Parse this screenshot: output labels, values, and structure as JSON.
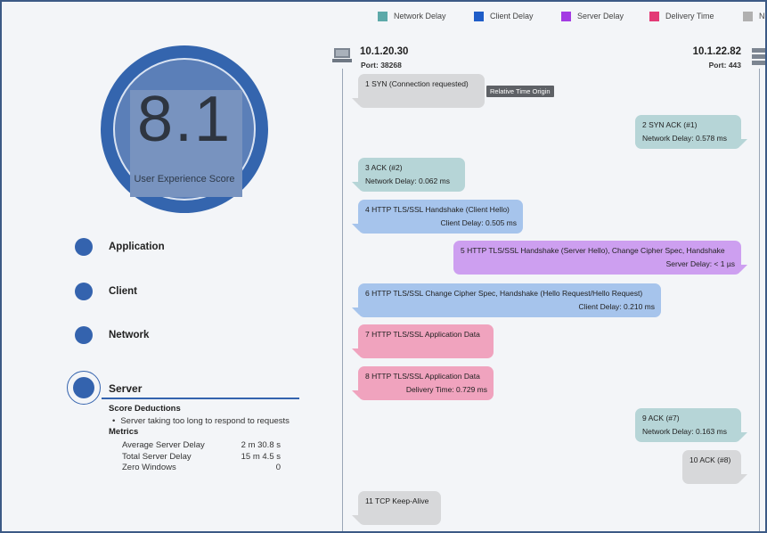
{
  "legend": [
    {
      "label": "Network Delay",
      "color": "#5da9a9"
    },
    {
      "label": "Client Delay",
      "color": "#1f5dc8"
    },
    {
      "label": "Server Delay",
      "color": "#a33be3"
    },
    {
      "label": "Delivery Time",
      "color": "#e33a76"
    },
    {
      "label": "N",
      "color": "#b0b0b0"
    }
  ],
  "score": {
    "value": "8.1",
    "label": "User Experience Score"
  },
  "categories": {
    "application": "Application",
    "client": "Client",
    "network": "Network",
    "server": "Server"
  },
  "details": {
    "deductions_heading": "Score Deductions",
    "deduction": "Server taking too long to respond to requests",
    "metrics_heading": "Metrics",
    "metrics": [
      {
        "name": "Average Server Delay",
        "value": "2 m 30.8 s"
      },
      {
        "name": "Total Server Delay",
        "value": "15 m 4.5 s"
      },
      {
        "name": "Zero Windows",
        "value": "0"
      }
    ]
  },
  "hosts": {
    "left": {
      "ip": "10.1.20.30",
      "port": "Port: 38268"
    },
    "right": {
      "ip": "10.1.22.82",
      "port": "Port: 443"
    }
  },
  "relative_time_origin": "Relative Time Origin",
  "messages": [
    {
      "l1": "1   SYN (Connection requested)",
      "l2": ""
    },
    {
      "l1": "2   SYN ACK (#1)",
      "l2": "Network Delay:  0.578 ms"
    },
    {
      "l1": "3   ACK (#2)",
      "l2": "Network Delay:  0.062 ms"
    },
    {
      "l1": "4   HTTP TLS/SSL Handshake (Client Hello)",
      "l2": "Client Delay:  0.505 ms"
    },
    {
      "l1": "5   HTTP TLS/SSL Handshake (Server Hello), Change Cipher Spec, Handshake",
      "l2": "Server Delay:  < 1 µs"
    },
    {
      "l1": "6   HTTP TLS/SSL Change Cipher Spec, Handshake (Hello Request/Hello Request)",
      "l2": "Client Delay:  0.210 ms"
    },
    {
      "l1": "7   HTTP TLS/SSL Application Data",
      "l2": ""
    },
    {
      "l1": "8   HTTP TLS/SSL Application Data",
      "l2": "Delivery Time:  0.729 ms"
    },
    {
      "l1": "9   ACK (#7)",
      "l2": "Network Delay:  0.163 ms"
    },
    {
      "l1": "10   ACK (#8)",
      "l2": ""
    },
    {
      "l1": "11   TCP Keep-Alive",
      "l2": ""
    }
  ]
}
